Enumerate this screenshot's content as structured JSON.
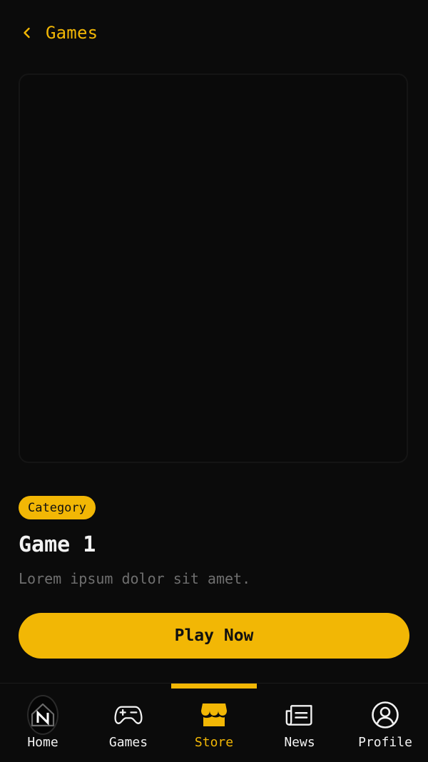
{
  "header": {
    "back_icon": "chevron-left-icon",
    "title": "Games"
  },
  "game": {
    "category": "Category",
    "title": "Game 1",
    "description": "Lorem ipsum dolor sit amet.",
    "play_label": "Play Now"
  },
  "tabbar": {
    "active": "Store",
    "items": [
      {
        "label": "Home",
        "icon": "home-n-icon"
      },
      {
        "label": "Games",
        "icon": "gamepad-icon"
      },
      {
        "label": "Store",
        "icon": "store-icon"
      },
      {
        "label": "News",
        "icon": "newspaper-icon"
      },
      {
        "label": "Profile",
        "icon": "profile-icon"
      }
    ]
  },
  "colors": {
    "accent": "#f2b705",
    "background": "#0b0b0b",
    "muted_text": "#6f6f6f",
    "text": "#f2f2f2"
  }
}
